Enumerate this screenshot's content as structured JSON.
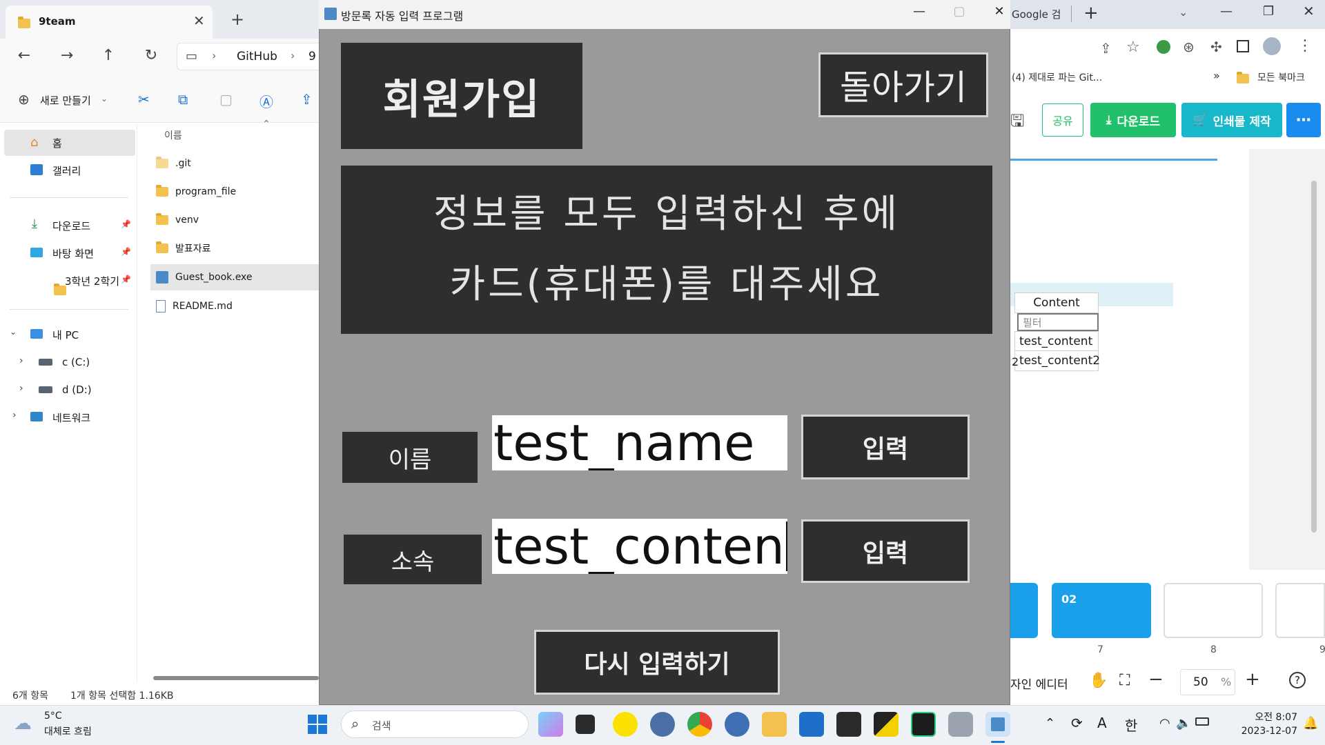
{
  "explorer": {
    "tab_title": "9team",
    "breadcrumb": [
      "GitHub",
      "9"
    ],
    "new_button": "새로 만들기",
    "column_name": "이름",
    "sidebar": {
      "home": "홈",
      "gallery": "갤러리",
      "downloads": "다운로드",
      "desktop": "바탕 화면",
      "semester": "3학년 2학기",
      "this_pc": "내 PC",
      "drive_c": "c (C:)",
      "drive_d": "d (D:)",
      "network": "네트워크"
    },
    "files": [
      ".git",
      "program_file",
      "venv",
      "발표자료",
      "Guest_book.exe",
      "README.md"
    ],
    "status_count": "6개 항목",
    "status_selected": "1개 항목 선택함 1.16KB"
  },
  "app": {
    "window_title": "방문록 자동 입력 프로그램",
    "signup_title": "회원가입",
    "back_button": "돌아가기",
    "instruction_line1": "정보를 모두 입력하신 후에",
    "instruction_line2": "카드(휴대폰)를 대주세요",
    "name_label": "이름",
    "name_value": "test_name",
    "name_submit": "입력",
    "affiliation_label": "소속",
    "affiliation_value": "test_conten",
    "affiliation_submit": "입력",
    "reset_button": "다시 입력하기"
  },
  "browser": {
    "tab_text": "Google 검",
    "bookmark_item": "(4) 제대로 파는 Git...",
    "bookmark_folder": "모든 북마크",
    "share_button": "공유",
    "download_button": "다운로드",
    "print_button": "인쇄물 제작",
    "table_header": "Content",
    "table_filter": "필터",
    "table_rows": [
      "test_content",
      "test_content2"
    ],
    "row_index_fragment": "2",
    "thumb_heading": "02",
    "thumb_pages": [
      "7",
      "8",
      "9"
    ],
    "editor_label": "자인 에디터",
    "zoom_value": "50",
    "zoom_unit": "%"
  },
  "taskbar": {
    "weather_temp": "5°C",
    "weather_desc": "대체로 흐림",
    "search_placeholder": "검색",
    "time": "오전 8:07",
    "date": "2023-12-07",
    "ime_a": "A",
    "ime_han": "한"
  },
  "colors": {
    "app_background": "#9a9a9a",
    "app_dark_panel": "#2e2e2e",
    "accent_green": "#21c16b",
    "accent_teal": "#18b7c9",
    "accent_blue": "#1a8cf0"
  }
}
